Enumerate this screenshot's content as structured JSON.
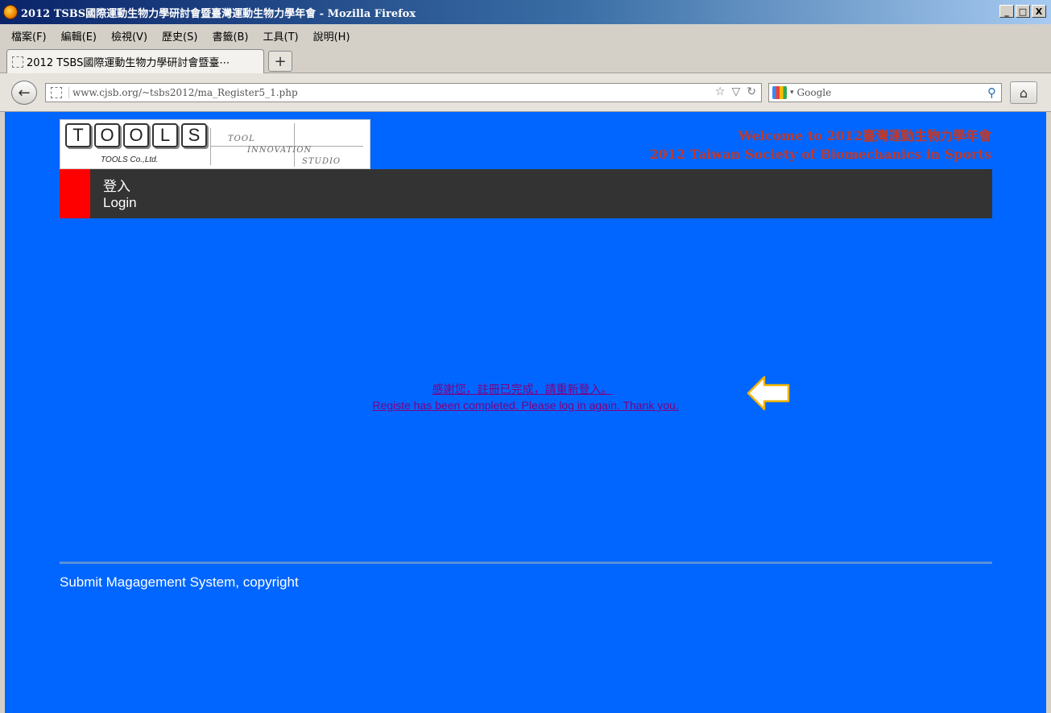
{
  "window": {
    "title": "2012 TSBS國際運動生物力學研討會暨臺灣運動生物力學年會 - Mozilla Firefox",
    "controls": [
      "_",
      "□",
      "X"
    ]
  },
  "menu": [
    "檔案(F)",
    "編輯(E)",
    "檢視(V)",
    "歷史(S)",
    "書籤(B)",
    "工具(T)",
    "說明(H)"
  ],
  "tabs": [
    {
      "label": "2012 TSBS國際運動生物力學研討會暨臺⋯"
    }
  ],
  "newtab_label": "+",
  "address": {
    "url": "www.cjsb.org/~tsbs2012/ma_Register5_1.php"
  },
  "search": {
    "engine": "Google",
    "placeholder": "Google"
  },
  "icons": {
    "back": "back-arrow-icon",
    "home": "home-icon",
    "bookmark_star": "star-icon",
    "reload": "reload-icon",
    "search": "magnifier-icon"
  },
  "logo": {
    "keys": [
      "T",
      "O",
      "O",
      "L",
      "S"
    ],
    "company": "TOOLS Co.,Ltd.",
    "tagline": [
      "TOOL",
      "INNOVATION",
      "STUDIO"
    ]
  },
  "header": {
    "welcome_line1": "Welcome to 2012臺灣運動生物力學年會",
    "welcome_line2": "2012 Taiwan Society of Biomechanics in Sports"
  },
  "nav": {
    "login_zh": "登入",
    "login_en": "Login"
  },
  "message": {
    "zh": "感謝您，註冊已完成，請重新登入。",
    "en": "Registe has been completed. Please log in again. Thank you."
  },
  "footer": {
    "text": "Submit Magagement System, copyright"
  },
  "colors": {
    "page_bg": "#0066ff",
    "nav_bg": "#333333",
    "nav_accent": "#ff0000",
    "welcome": "#c0392b",
    "link_visited": "#800080",
    "arrow_fill": "#ffffff",
    "arrow_stroke": "#f0b400"
  }
}
